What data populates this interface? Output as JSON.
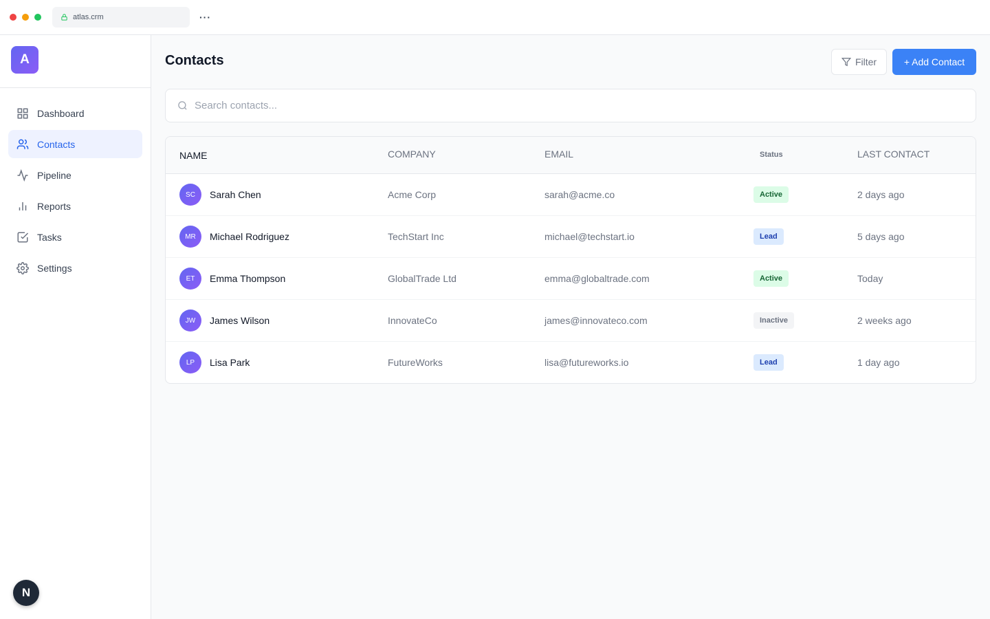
{
  "browser": {
    "url": "atlas.crm",
    "more": "···"
  },
  "sidebar": {
    "logo": "A",
    "items": [
      {
        "label": "Dashboard",
        "icon": "grid-icon"
      },
      {
        "label": "Contacts",
        "icon": "users-icon",
        "active": true
      },
      {
        "label": "Pipeline",
        "icon": "activity-icon"
      },
      {
        "label": "Reports",
        "icon": "bar-chart-icon"
      },
      {
        "label": "Tasks",
        "icon": "check-square-icon"
      },
      {
        "label": "Settings",
        "icon": "gear-icon"
      }
    ],
    "badge": "N"
  },
  "header": {
    "title": "Contacts",
    "filter_label": "Filter",
    "add_label": "+ Add Contact"
  },
  "search": {
    "placeholder": "Search contacts..."
  },
  "table": {
    "columns": [
      "NAME",
      "COMPANY",
      "EMAIL",
      "Status",
      "LAST CONTACT"
    ],
    "rows": [
      {
        "initials": "SC",
        "name": "Sarah Chen",
        "company": "Acme Corp",
        "email": "sarah@acme.co",
        "status": "Active",
        "last": "2 days ago"
      },
      {
        "initials": "MR",
        "name": "Michael Rodriguez",
        "company": "TechStart Inc",
        "email": "michael@techstart.io",
        "status": "Lead",
        "last": "5 days ago"
      },
      {
        "initials": "ET",
        "name": "Emma Thompson",
        "company": "GlobalTrade Ltd",
        "email": "emma@globaltrade.com",
        "status": "Active",
        "last": "Today"
      },
      {
        "initials": "JW",
        "name": "James Wilson",
        "company": "InnovateCo",
        "email": "james@innovateco.com",
        "status": "Inactive",
        "last": "2 weeks ago"
      },
      {
        "initials": "LP",
        "name": "Lisa Park",
        "company": "FutureWorks",
        "email": "lisa@futureworks.io",
        "status": "Lead",
        "last": "1 day ago"
      }
    ]
  },
  "colors": {
    "accent": "#3b82f6",
    "brand": "#6366f1",
    "active_bg": "#dcfce7",
    "lead_bg": "#dbeafe",
    "inactive_bg": "#f3f4f6"
  }
}
